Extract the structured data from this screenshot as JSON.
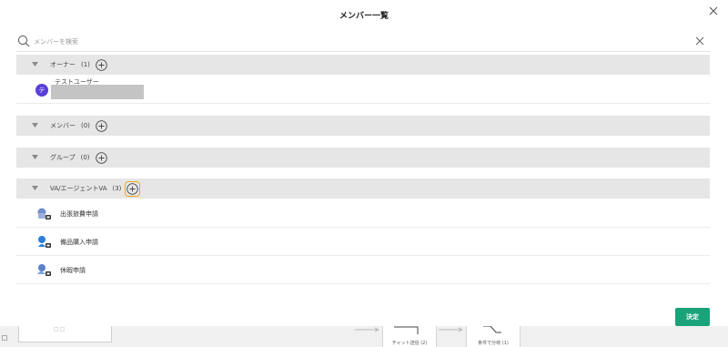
{
  "modal": {
    "title": "メンバー一覧",
    "search_placeholder": "メンバーを検索"
  },
  "groups": [
    {
      "label": "オーナー",
      "count": "(1)"
    },
    {
      "label": "メンバー",
      "count": "(0)"
    },
    {
      "label": "グループ",
      "count": "(0)"
    },
    {
      "label": "VA/エージェントVA",
      "count": "(3)"
    }
  ],
  "owners": [
    {
      "avatar": "テ",
      "name": "テストユーザー"
    }
  ],
  "agents": [
    {
      "label": "出張旅費申請",
      "icon": "agent-suitcase-icon"
    },
    {
      "label": "備品購入申請",
      "icon": "agent-person-icon"
    },
    {
      "label": "休暇申請",
      "icon": "agent-beach-icon"
    }
  ],
  "footer": {
    "confirm": "決定"
  },
  "background": {
    "box_text": "□□",
    "node_chat": "チャット送信 (2)",
    "node_branch": "条件で分岐 (1)"
  },
  "colors": {
    "accent": "#1aa37a",
    "avatar": "#5b3fd9",
    "highlight": "#f2a81d",
    "group_bg": "#e6e6e6"
  }
}
